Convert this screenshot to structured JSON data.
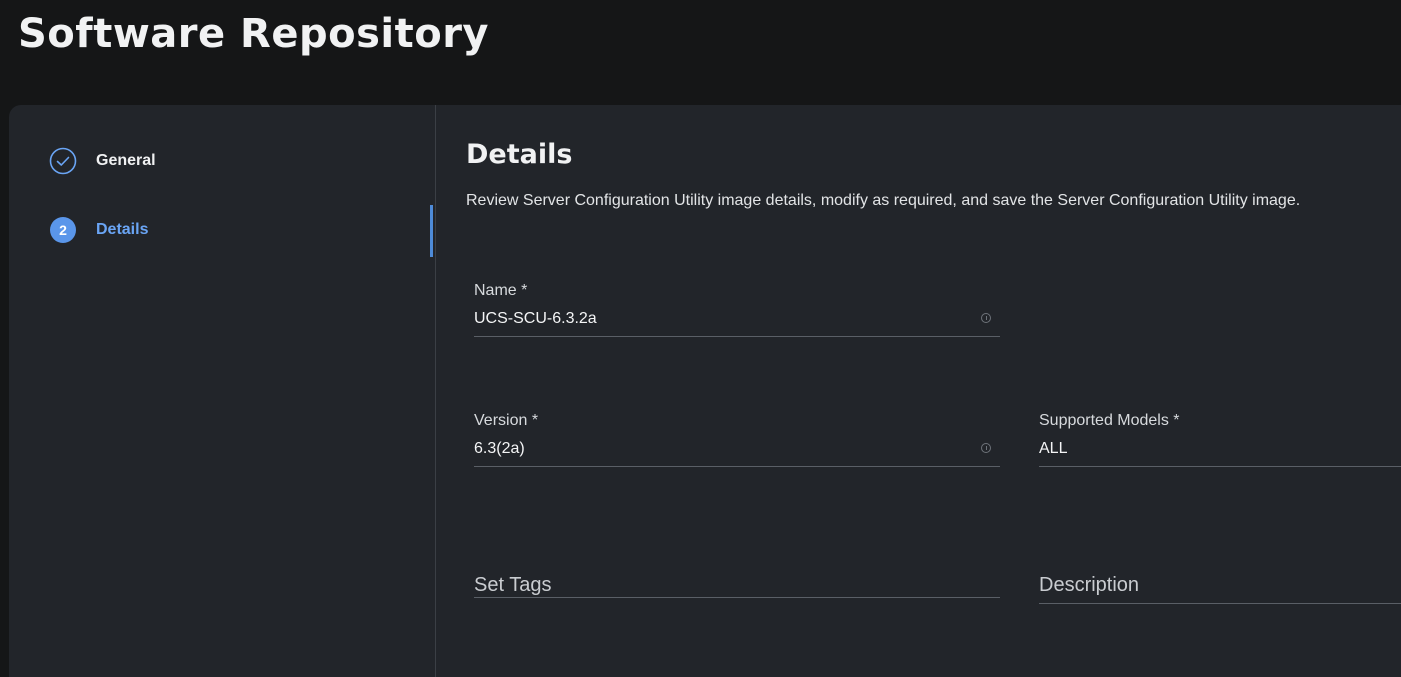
{
  "header": {
    "title": "Software Repository"
  },
  "steps": [
    {
      "label": "General",
      "status": "completed",
      "icon": "check-circle-icon"
    },
    {
      "number": "2",
      "label": "Details",
      "status": "active"
    }
  ],
  "details": {
    "title": "Details",
    "description": "Review Server Configuration Utility image details, modify as required, and save the Server Configuration Utility image.",
    "fields": {
      "name": {
        "label": "Name *",
        "value": "UCS-SCU-6.3.2a"
      },
      "version": {
        "label": "Version *",
        "value": "6.3(2a)"
      },
      "supported_models": {
        "label": "Supported Models *",
        "value": "ALL"
      },
      "tags": {
        "placeholder": "Set Tags"
      },
      "description": {
        "placeholder": "Description"
      }
    }
  },
  "colors": {
    "page_background": "#151617",
    "panel_background": "#22252a",
    "accent_blue": "#5a96ea",
    "active_step_text": "#6aa5f5"
  }
}
